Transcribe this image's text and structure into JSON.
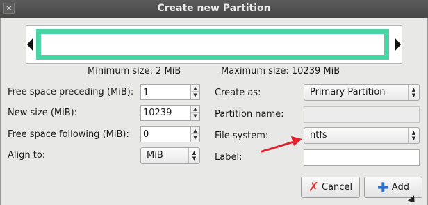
{
  "window": {
    "title": "Create new Partition",
    "close_glyph": "✕"
  },
  "sizes": {
    "minimum": "Minimum size: 2 MiB",
    "maximum": "Maximum size: 10239 MiB"
  },
  "left": {
    "free_preceding": {
      "label": "Free space preceding (MiB):",
      "value": "1"
    },
    "new_size": {
      "label": "New size (MiB):",
      "value": "10239"
    },
    "free_following": {
      "label": "Free space following (MiB):",
      "value": "0"
    },
    "align": {
      "label": "Align to:",
      "value": "MiB"
    }
  },
  "right": {
    "create_as": {
      "label": "Create as:",
      "value": "Primary Partition"
    },
    "partition_name": {
      "label": "Partition name:",
      "value": ""
    },
    "file_system": {
      "label": "File system:",
      "value": "ntfs"
    },
    "fs_label": {
      "label": "Label:",
      "value": ""
    }
  },
  "buttons": {
    "cancel": "Cancel",
    "add": "Add"
  },
  "colors": {
    "partition_bar": "#48d4a4",
    "annotation_arrow": "#e0202a"
  },
  "icons": {
    "cancel": "cancel-x-icon",
    "add": "add-plus-icon",
    "spin_up": "▲",
    "spin_down": "▼",
    "combo_up": "▲",
    "combo_down": "▼"
  }
}
